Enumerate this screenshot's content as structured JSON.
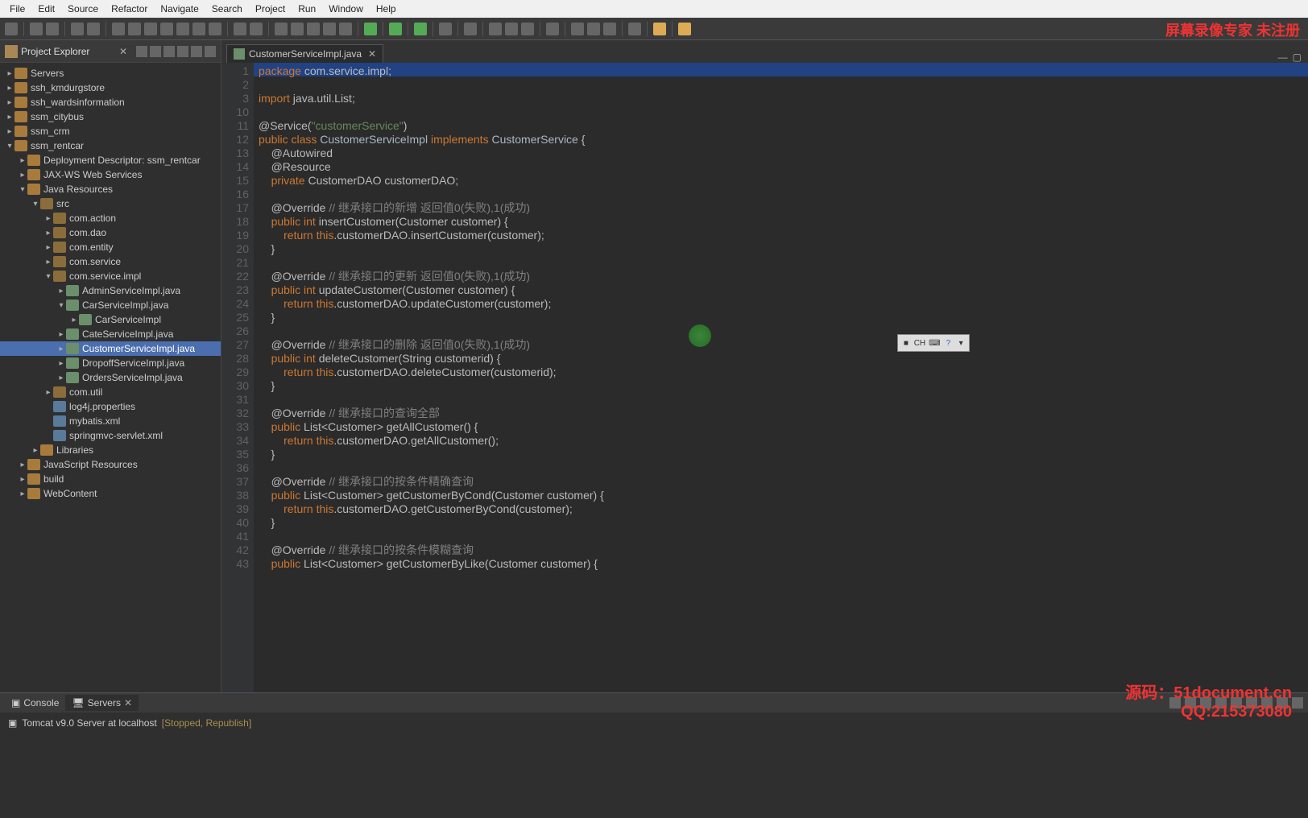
{
  "menu": [
    "File",
    "Edit",
    "Source",
    "Refactor",
    "Navigate",
    "Search",
    "Project",
    "Run",
    "Window",
    "Help"
  ],
  "watermark_top": "屏幕录像专家 未注册",
  "watermark_bottom_1": "源码：51document.cn",
  "watermark_bottom_2": "QQ:215373080",
  "explorer": {
    "title": "Project Explorer",
    "items": [
      {
        "depth": 0,
        "arrow": "▸",
        "ico": "proj",
        "label": "Servers"
      },
      {
        "depth": 0,
        "arrow": "▸",
        "ico": "proj",
        "label": "ssh_kmdurgstore"
      },
      {
        "depth": 0,
        "arrow": "▸",
        "ico": "proj",
        "label": "ssh_wardsinformation"
      },
      {
        "depth": 0,
        "arrow": "▸",
        "ico": "proj",
        "label": "ssm_citybus"
      },
      {
        "depth": 0,
        "arrow": "▸",
        "ico": "proj",
        "label": "ssm_crm"
      },
      {
        "depth": 0,
        "arrow": "▾",
        "ico": "proj",
        "label": "ssm_rentcar"
      },
      {
        "depth": 1,
        "arrow": "▸",
        "ico": "folder",
        "label": "Deployment Descriptor: ssm_rentcar"
      },
      {
        "depth": 1,
        "arrow": "▸",
        "ico": "folder",
        "label": "JAX-WS Web Services"
      },
      {
        "depth": 1,
        "arrow": "▾",
        "ico": "folder",
        "label": "Java Resources"
      },
      {
        "depth": 2,
        "arrow": "▾",
        "ico": "pkg",
        "label": "src"
      },
      {
        "depth": 3,
        "arrow": "▸",
        "ico": "pkg",
        "label": "com.action"
      },
      {
        "depth": 3,
        "arrow": "▸",
        "ico": "pkg",
        "label": "com.dao"
      },
      {
        "depth": 3,
        "arrow": "▸",
        "ico": "pkg",
        "label": "com.entity"
      },
      {
        "depth": 3,
        "arrow": "▸",
        "ico": "pkg",
        "label": "com.service"
      },
      {
        "depth": 3,
        "arrow": "▾",
        "ico": "pkg",
        "label": "com.service.impl"
      },
      {
        "depth": 4,
        "arrow": "▸",
        "ico": "java",
        "label": "AdminServiceImpl.java"
      },
      {
        "depth": 4,
        "arrow": "▾",
        "ico": "java",
        "label": "CarServiceImpl.java"
      },
      {
        "depth": 5,
        "arrow": "▸",
        "ico": "java",
        "label": "CarServiceImpl"
      },
      {
        "depth": 4,
        "arrow": "▸",
        "ico": "java",
        "label": "CateServiceImpl.java"
      },
      {
        "depth": 4,
        "arrow": "▸",
        "ico": "java",
        "label": "CustomerServiceImpl.java",
        "selected": true
      },
      {
        "depth": 4,
        "arrow": "▸",
        "ico": "java",
        "label": "DropoffServiceImpl.java"
      },
      {
        "depth": 4,
        "arrow": "▸",
        "ico": "java",
        "label": "OrdersServiceImpl.java"
      },
      {
        "depth": 3,
        "arrow": "▸",
        "ico": "pkg",
        "label": "com.util"
      },
      {
        "depth": 3,
        "arrow": "",
        "ico": "file",
        "label": "log4j.properties"
      },
      {
        "depth": 3,
        "arrow": "",
        "ico": "file",
        "label": "mybatis.xml"
      },
      {
        "depth": 3,
        "arrow": "",
        "ico": "file",
        "label": "springmvc-servlet.xml"
      },
      {
        "depth": 2,
        "arrow": "▸",
        "ico": "folder",
        "label": "Libraries"
      },
      {
        "depth": 1,
        "arrow": "▸",
        "ico": "folder",
        "label": "JavaScript Resources"
      },
      {
        "depth": 1,
        "arrow": "▸",
        "ico": "folder",
        "label": "build"
      },
      {
        "depth": 1,
        "arrow": "▸",
        "ico": "folder",
        "label": "WebContent"
      }
    ]
  },
  "editor": {
    "tab_title": "CustomerServiceImpl.java",
    "line_numbers": [
      "1",
      "2",
      "3",
      "10",
      "11",
      "12",
      "13",
      "14",
      "15",
      "16",
      "17",
      "18",
      "19",
      "20",
      "21",
      "22",
      "23",
      "24",
      "25",
      "26",
      "27",
      "28",
      "29",
      "30",
      "31",
      "32",
      "33",
      "34",
      "35",
      "36",
      "37",
      "38",
      "39",
      "40",
      "41",
      "42",
      "43"
    ],
    "code_html": "<span class='kw'>package</span> com.service.impl;\n\n<span class='kw'>import</span> java.util.List;\n\n<span class='ann'>@Service(</span><span class='str'>\"customerService\"</span><span class='ann'>)</span>\n<span class='kw'>public class</span> <span class='typ'>CustomerServiceImpl</span> <span class='kw'>implements</span> <span class='typ'>CustomerService</span> {\n    <span class='ann'>@Autowired</span>\n    <span class='ann'>@Resource</span>\n    <span class='kw'>private</span> CustomerDAO customerDAO;\n\n    <span class='ann'>@Override</span> <span class='cmt'>// 继承接口的新增 返回值0(失败),1(成功)</span>\n    <span class='kw'>public int</span> insertCustomer(Customer customer) {\n        <span class='kw'>return this</span>.customerDAO.insertCustomer(customer);\n    }\n\n    <span class='ann'>@Override</span> <span class='cmt'>// 继承接口的更新 返回值0(失败),1(成功)</span>\n    <span class='kw'>public int</span> updateCustomer(Customer customer) {\n        <span class='kw'>return this</span>.customerDAO.updateCustomer(customer);\n    }\n\n    <span class='ann'>@Override</span> <span class='cmt'>// 继承接口的删除 返回值0(失败),1(成功)</span>\n    <span class='kw'>public int</span> deleteCustomer(String customerid) {\n        <span class='kw'>return this</span>.customerDAO.deleteCustomer(customerid);\n    }\n\n    <span class='ann'>@Override</span> <span class='cmt'>// 继承接口的查询全部</span>\n    <span class='kw'>public</span> List&lt;Customer&gt; getAllCustomer() {\n        <span class='kw'>return this</span>.customerDAO.getAllCustomer();\n    }\n\n    <span class='ann'>@Override</span> <span class='cmt'>// 继承接口的按条件精确查询</span>\n    <span class='kw'>public</span> List&lt;Customer&gt; getCustomerByCond(Customer customer) {\n        <span class='kw'>return this</span>.customerDAO.getCustomerByCond(customer);\n    }\n\n    <span class='ann'>@Override</span> <span class='cmt'>// 继承接口的按条件模糊查询</span>\n    <span class='kw'>public</span> List&lt;Customer&gt; getCustomerByLike(Customer customer) {"
  },
  "ime": {
    "label": "CH"
  },
  "bottom": {
    "tabs": [
      {
        "label": "Console"
      },
      {
        "label": "Servers",
        "active": true
      }
    ],
    "server_name": "Tomcat v9.0 Server at localhost",
    "server_status": "[Stopped, Republish]"
  }
}
